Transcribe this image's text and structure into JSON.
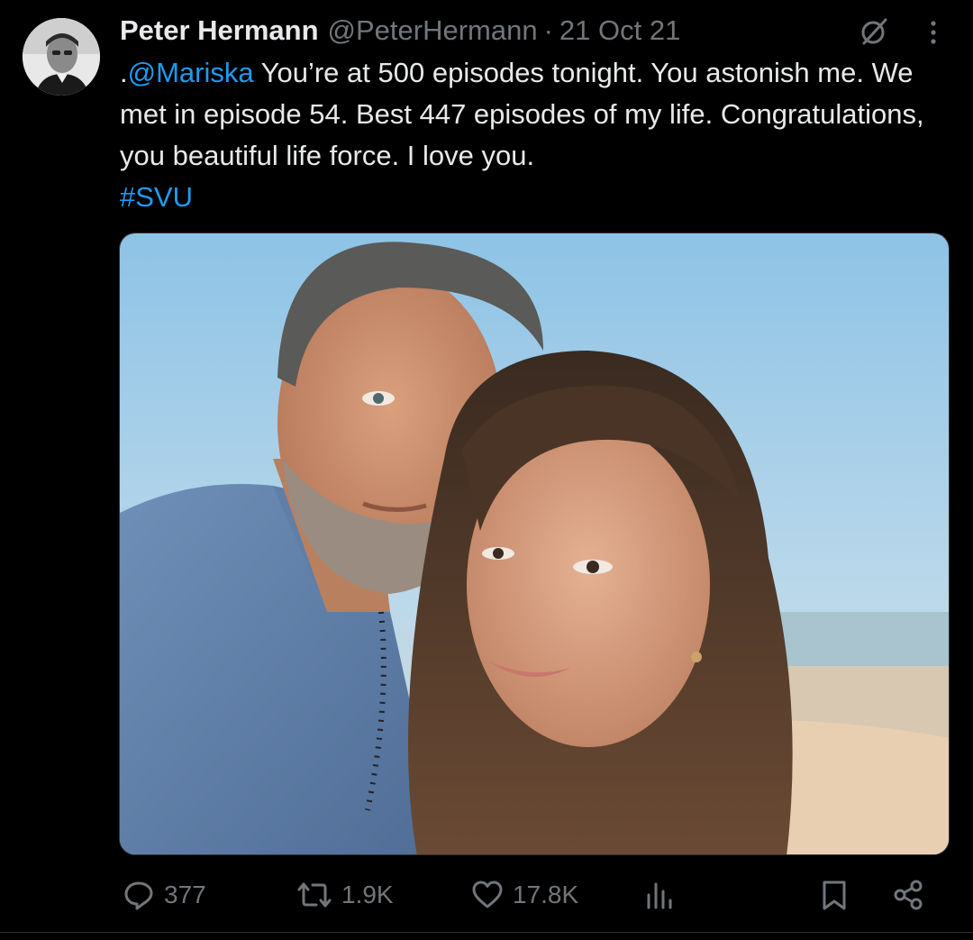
{
  "author": {
    "name": "Peter Hermann",
    "handle": "@PeterHermann",
    "separator": "·",
    "date": "21 Oct 21",
    "avatar_icon": "profile-avatar"
  },
  "tweet": {
    "prefix": ".",
    "mention": "@Mariska",
    "body": " You’re at 500 episodes tonight. You astonish me. We met in episode 54. Best 447 episodes of my life. Congratulations, you beautiful life force. I love you.",
    "hashtag": "#SVU"
  },
  "media": {
    "type": "photo",
    "description_icon": "selfie-photo"
  },
  "actions": {
    "replies": "377",
    "reposts": "1.9K",
    "likes": "17.8K",
    "reply_icon": "reply-icon",
    "repost_icon": "repost-icon",
    "like_icon": "heart-icon",
    "views_icon": "analytics-icon",
    "bookmark_icon": "bookmark-icon",
    "share_icon": "share-icon"
  },
  "colors": {
    "background": "#000000",
    "text": "#e7e9ea",
    "muted": "#71767b",
    "link": "#1d9bf0"
  }
}
